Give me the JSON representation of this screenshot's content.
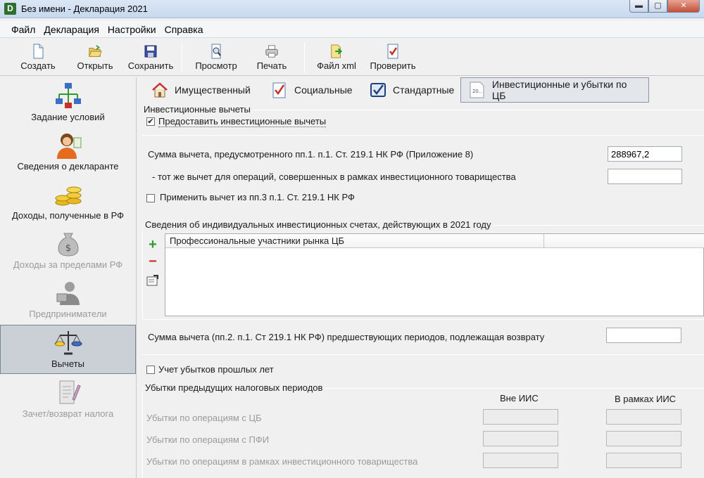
{
  "window": {
    "title": "Без имени - Декларация 2021",
    "app_icon_letter": "D"
  },
  "menu": [
    "Файл",
    "Декларация",
    "Настройки",
    "Справка"
  ],
  "toolbar": {
    "create": "Создать",
    "open": "Открыть",
    "save": "Сохранить",
    "preview": "Просмотр",
    "print": "Печать",
    "xml": "Файл xml",
    "check": "Проверить"
  },
  "sidebar": {
    "items": [
      {
        "label": "Задание условий",
        "icon": "flowchart-icon",
        "enabled": true
      },
      {
        "label": "Сведения о декларанте",
        "icon": "person-icon",
        "enabled": true
      },
      {
        "label": "Доходы, полученные в РФ",
        "icon": "coins-icon",
        "enabled": true
      },
      {
        "label": "Доходы за пределами РФ",
        "icon": "money-bag-icon",
        "enabled": false
      },
      {
        "label": "Предприниматели",
        "icon": "businessman-icon",
        "enabled": false
      },
      {
        "label": "Вычеты",
        "icon": "scales-icon",
        "enabled": true,
        "active": true
      },
      {
        "label": "Зачет/возврат налога",
        "icon": "document-pen-icon",
        "enabled": false
      }
    ]
  },
  "tabs": [
    {
      "label": "Имущественный",
      "icon": "house-icon"
    },
    {
      "label": "Социальные",
      "icon": "checklist-icon"
    },
    {
      "label": "Стандартные",
      "icon": "check-tablet-icon"
    },
    {
      "label": "Инвестиционные и убытки по ЦБ",
      "icon": "calendar-icon",
      "icon_text": "20..",
      "active": true
    }
  ],
  "investment": {
    "legend": "Инвестиционные вычеты",
    "provide_checkbox": {
      "label": "Предоставить инвестиционные вычеты",
      "checked": true
    },
    "sum_label": "Сумма вычета, предусмотренного пп.1. п.1. Ст. 219.1 НК РФ (Приложение 8)",
    "sum_value": "288967,2",
    "same_label": "- тот же вычет для операций, совершенных в рамках инвестиционного товарищества",
    "same_value": "",
    "apply_checkbox": {
      "label": "Применить вычет из пп.3 п.1. Ст. 219.1 НК РФ",
      "checked": false
    }
  },
  "iis": {
    "legend": "Сведения об индивидуальных инвестиционных счетах, действующих в 2021 году",
    "column_header": "Профессиональные участники рынка ЦБ",
    "rows": [],
    "prev_label": "Сумма вычета (пп.2. п.1. Ст 219.1 НК РФ) предшествующих периодов, подлежащая возврату",
    "prev_value": ""
  },
  "losses": {
    "checkbox": {
      "label": "Учет убытков прошлых лет",
      "checked": false
    },
    "legend": "Убытки предыдущих налоговых периодов",
    "col_outside": "Вне ИИС",
    "col_inside": "В рамках ИИС",
    "rows": [
      {
        "label": "Убытки по операциям с ЦБ",
        "outside": "",
        "inside": ""
      },
      {
        "label": "Убытки по операциям с ПФИ",
        "outside": "",
        "inside": ""
      },
      {
        "label": "Убытки по операциям в рамках инвестиционного товарищества",
        "outside": "",
        "inside": ""
      }
    ]
  },
  "colors": {
    "accent_active": "#cbcfd6",
    "add_green": "#2d9a2d",
    "remove_red": "#c8312a"
  }
}
